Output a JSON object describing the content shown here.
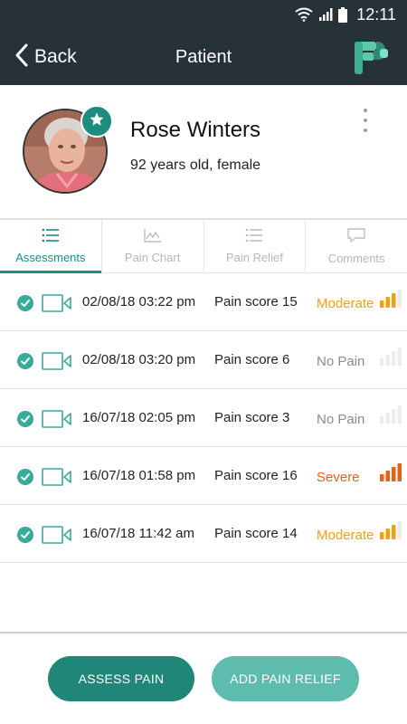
{
  "status_bar": {
    "time": "12:11"
  },
  "header": {
    "back_label": "Back",
    "title": "Patient"
  },
  "patient": {
    "name": "Rose Winters",
    "details": "92 years old, female"
  },
  "tabs": [
    {
      "label": "Assessments",
      "icon": "list-icon",
      "active": true
    },
    {
      "label": "Pain Chart",
      "icon": "chart-icon",
      "active": false
    },
    {
      "label": "Pain Relief",
      "icon": "list-icon",
      "active": false
    },
    {
      "label": "Comments",
      "icon": "comment-icon",
      "active": false
    }
  ],
  "assessments": [
    {
      "datetime": "02/08/18 03:22 pm",
      "score": "Pain score 15",
      "severity": "Moderate",
      "level": 3,
      "color": "#f0a015"
    },
    {
      "datetime": "02/08/18 03:20 pm",
      "score": "Pain score 6",
      "severity": "No Pain",
      "level": 0,
      "color": "#8a8a8a"
    },
    {
      "datetime": "16/07/18 02:05 pm",
      "score": "Pain score 3",
      "severity": "No Pain",
      "level": 0,
      "color": "#8a8a8a"
    },
    {
      "datetime": "16/07/18 01:58 pm",
      "score": "Pain score 16",
      "severity": "Severe",
      "level": 4,
      "color": "#e2621a"
    },
    {
      "datetime": "16/07/18 11:42 am",
      "score": "Pain score 14",
      "severity": "Moderate",
      "level": 3,
      "color": "#f0a015"
    }
  ],
  "actions": {
    "assess_label": "ASSESS PAIN",
    "relief_label": "ADD PAIN RELIEF"
  },
  "colors": {
    "primary": "#1f8678",
    "secondary": "#5ebcaf",
    "header_bg": "#263238",
    "moderate": "#f0a015",
    "severe": "#e2621a"
  }
}
